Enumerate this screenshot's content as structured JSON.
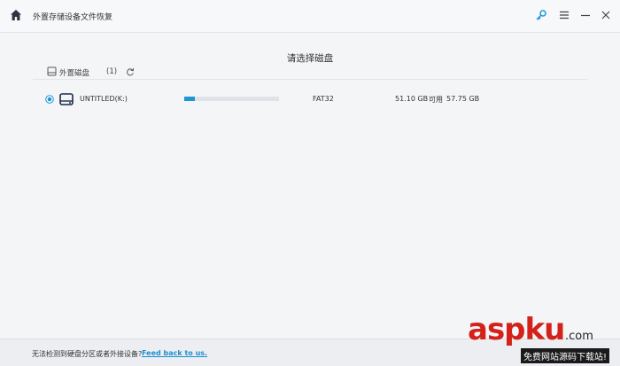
{
  "app": {
    "title": "外置存储设备文件恢复"
  },
  "toolbar": {
    "icons": [
      "home-icon",
      "key-icon",
      "menu-icon",
      "minimize-icon",
      "close-icon"
    ],
    "accent_color": "#1e96d6"
  },
  "main": {
    "heading": "请选择磁盘",
    "group": {
      "label": "外置磁盘",
      "count": "(1)"
    },
    "disks": [
      {
        "name": "UNTITLED(K:)",
        "selected": true,
        "usage_fraction": 0.11,
        "filesystem": "FAT32",
        "free": "51.10 GB",
        "free_label": "可用",
        "total": "57.75 GB"
      }
    ]
  },
  "footer": {
    "text": "无法检测到硬盘分区或者外接设备?",
    "link": "Feed back to us."
  },
  "watermark": {
    "main": "aspku",
    "sub": ".com",
    "caption": "免费网站源码下载站!"
  }
}
